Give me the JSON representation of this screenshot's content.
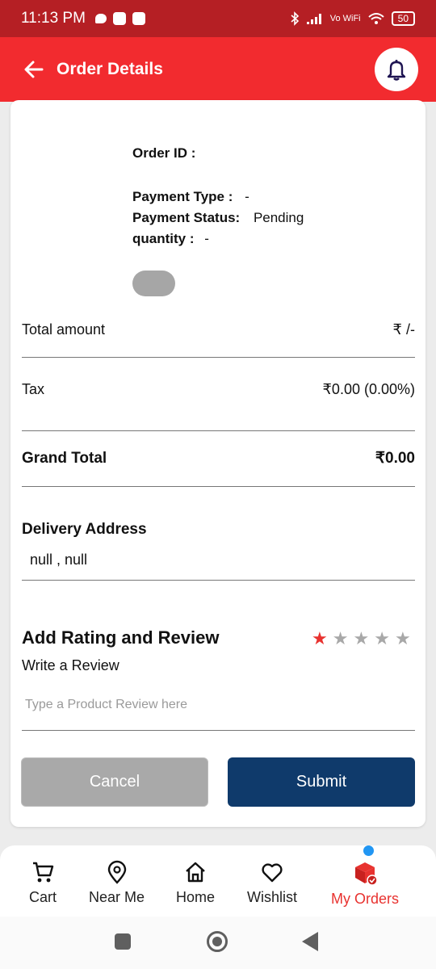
{
  "status_bar": {
    "time": "11:13 PM",
    "network": "Vo WiFi",
    "battery": "50"
  },
  "app_bar": {
    "title": "Order Details"
  },
  "order": {
    "order_id_label": "Order ID :",
    "payment_type_label": "Payment Type :",
    "payment_type_value": "-",
    "payment_status_label": "Payment Status:",
    "payment_status_value": "Pending",
    "quantity_label": "quantity :",
    "quantity_value": "-"
  },
  "summary": {
    "total_amount_label": "Total amount",
    "total_amount_value": "₹ /-",
    "tax_label": "Tax",
    "tax_value": "₹0.00 (0.00%)",
    "grand_total_label": "Grand Total",
    "grand_total_value": "₹0.00"
  },
  "delivery": {
    "heading": "Delivery Address",
    "address": "null , null"
  },
  "review": {
    "heading": "Add Rating and Review",
    "subheading": "Write a Review",
    "placeholder": "Type a Product Review here",
    "rating": 1,
    "max_rating": 5,
    "star_active_color": "#e8322f",
    "star_inactive_color": "#a8a8a8"
  },
  "buttons": {
    "cancel": "Cancel",
    "submit": "Submit"
  },
  "bottom_nav": {
    "items": [
      {
        "label": "Cart",
        "icon": "cart-icon"
      },
      {
        "label": "Near Me",
        "icon": "location-pin-icon"
      },
      {
        "label": "Home",
        "icon": "home-icon"
      },
      {
        "label": "Wishlist",
        "icon": "heart-icon"
      },
      {
        "label": "My Orders",
        "icon": "box-icon",
        "active": true
      }
    ]
  },
  "colors": {
    "primary": "#f22b2f",
    "status_bar": "#b51f24",
    "submit": "#0f3a6b",
    "cancel": "#a9a9a9"
  }
}
